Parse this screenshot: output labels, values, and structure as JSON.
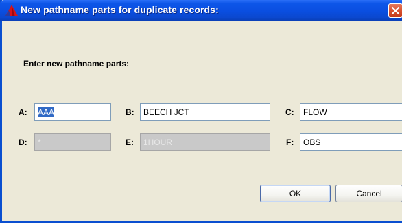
{
  "window": {
    "title": "New pathname parts for duplicate records:"
  },
  "dialog": {
    "prompt": "Enter new pathname parts:",
    "fields": {
      "a": {
        "label": "A:",
        "value": "AAA",
        "selected": true,
        "enabled": true
      },
      "b": {
        "label": "B:",
        "value": "BEECH JCT",
        "enabled": true
      },
      "c": {
        "label": "C:",
        "value": "FLOW",
        "enabled": true
      },
      "d": {
        "label": "D:",
        "value": "*",
        "enabled": false
      },
      "e": {
        "label": "E:",
        "value": "1HOUR",
        "enabled": false
      },
      "f": {
        "label": "F:",
        "value": "OBS",
        "enabled": true
      }
    },
    "buttons": {
      "ok": "OK",
      "cancel": "Cancel"
    }
  },
  "icons": {
    "app": "red-triangle-app-icon",
    "close": "close-icon"
  },
  "colors": {
    "titlebar": "#0a4ee0",
    "dialog_background": "#ece9d8",
    "close_button": "#d9512f",
    "selection": "#316ac5",
    "disabled_field": "#c9c9c9"
  }
}
